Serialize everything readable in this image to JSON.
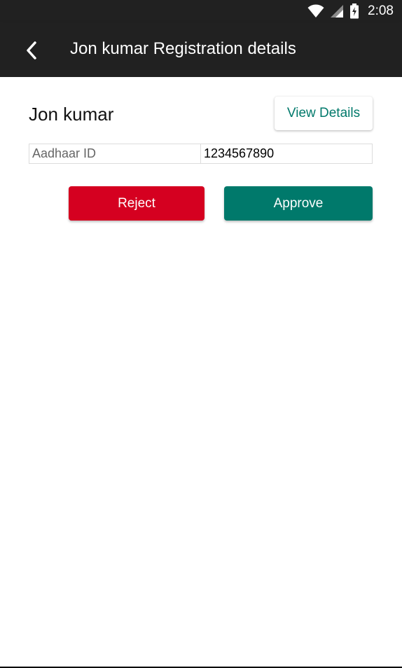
{
  "status_bar": {
    "time": "2:08",
    "icons": [
      "wifi-icon",
      "signal-icon",
      "battery-charging-icon"
    ]
  },
  "app_bar": {
    "title": "Jon kumar Registration details",
    "back_icon": "chevron-left-icon"
  },
  "profile": {
    "name": "Jon kumar",
    "view_details_label": "View Details"
  },
  "details": {
    "rows": [
      {
        "label": "Aadhaar ID",
        "value": "1234567890"
      }
    ]
  },
  "actions": {
    "reject_label": "Reject",
    "approve_label": "Approve"
  },
  "colors": {
    "app_bar": "#212121",
    "accent": "#00796b",
    "reject": "#d50020"
  }
}
